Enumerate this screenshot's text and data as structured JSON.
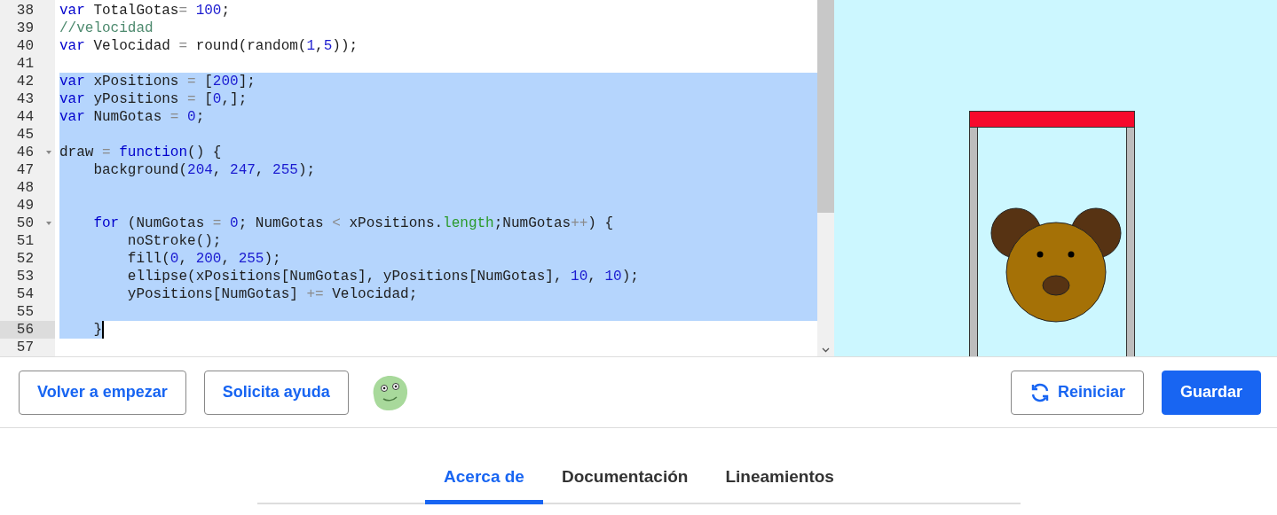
{
  "editor": {
    "lines": [
      {
        "number": "38",
        "selected": false,
        "active": false,
        "foldable": false,
        "tokens": [
          {
            "text": "var",
            "kind": "keyword"
          },
          {
            "text": " TotalGotas",
            "kind": "plain"
          },
          {
            "text": "=",
            "kind": "operator"
          },
          {
            "text": " 100",
            "kind": "number"
          },
          {
            "text": ";",
            "kind": "plain"
          }
        ]
      },
      {
        "number": "39",
        "selected": false,
        "active": false,
        "foldable": false,
        "tokens": [
          {
            "text": "//velocidad",
            "kind": "comment"
          }
        ]
      },
      {
        "number": "40",
        "selected": false,
        "active": false,
        "foldable": false,
        "tokens": [
          {
            "text": "var",
            "kind": "keyword"
          },
          {
            "text": " Velocidad ",
            "kind": "plain"
          },
          {
            "text": "=",
            "kind": "operator"
          },
          {
            "text": " round(random(",
            "kind": "plain"
          },
          {
            "text": "1",
            "kind": "number"
          },
          {
            "text": ",",
            "kind": "plain"
          },
          {
            "text": "5",
            "kind": "number"
          },
          {
            "text": "));",
            "kind": "plain"
          }
        ]
      },
      {
        "number": "41",
        "selected": false,
        "active": false,
        "foldable": false
      },
      {
        "number": "42",
        "selected": true,
        "active": false,
        "foldable": false,
        "tokens": [
          {
            "text": "var",
            "kind": "keyword"
          },
          {
            "text": " xPositions ",
            "kind": "plain"
          },
          {
            "text": "=",
            "kind": "operator"
          },
          {
            "text": " [",
            "kind": "plain"
          },
          {
            "text": "200",
            "kind": "number"
          },
          {
            "text": "];",
            "kind": "plain"
          }
        ]
      },
      {
        "number": "43",
        "selected": true,
        "active": false,
        "foldable": false,
        "tokens": [
          {
            "text": "var",
            "kind": "keyword"
          },
          {
            "text": " yPositions ",
            "kind": "plain"
          },
          {
            "text": "=",
            "kind": "operator"
          },
          {
            "text": " [",
            "kind": "plain"
          },
          {
            "text": "0",
            "kind": "number"
          },
          {
            "text": ",];",
            "kind": "plain"
          }
        ]
      },
      {
        "number": "44",
        "selected": true,
        "active": false,
        "foldable": false,
        "tokens": [
          {
            "text": "var",
            "kind": "keyword"
          },
          {
            "text": " NumGotas ",
            "kind": "plain"
          },
          {
            "text": "=",
            "kind": "operator"
          },
          {
            "text": " 0",
            "kind": "number"
          },
          {
            "text": ";",
            "kind": "plain"
          }
        ]
      },
      {
        "number": "45",
        "selected": true,
        "active": false,
        "foldable": false
      },
      {
        "number": "46",
        "selected": true,
        "active": false,
        "foldable": true,
        "tokens": [
          {
            "text": "draw ",
            "kind": "plain"
          },
          {
            "text": "=",
            "kind": "operator"
          },
          {
            "text": " function",
            "kind": "keyword"
          },
          {
            "text": "() {",
            "kind": "plain"
          }
        ]
      },
      {
        "number": "47",
        "selected": true,
        "active": false,
        "foldable": false,
        "tokens": [
          {
            "text": "    background(",
            "kind": "plain"
          },
          {
            "text": "204",
            "kind": "number"
          },
          {
            "text": ", ",
            "kind": "plain"
          },
          {
            "text": "247",
            "kind": "number"
          },
          {
            "text": ", ",
            "kind": "plain"
          },
          {
            "text": "255",
            "kind": "number"
          },
          {
            "text": ");",
            "kind": "plain"
          }
        ]
      },
      {
        "number": "48",
        "selected": true,
        "active": false,
        "foldable": false
      },
      {
        "number": "49",
        "selected": true,
        "active": false,
        "foldable": false
      },
      {
        "number": "50",
        "selected": true,
        "active": false,
        "foldable": true,
        "tokens": [
          {
            "text": "    for",
            "kind": "keyword"
          },
          {
            "text": " (NumGotas ",
            "kind": "plain"
          },
          {
            "text": "=",
            "kind": "operator"
          },
          {
            "text": " 0",
            "kind": "number"
          },
          {
            "text": "; NumGotas ",
            "kind": "plain"
          },
          {
            "text": "<",
            "kind": "operator"
          },
          {
            "text": " xPositions.",
            "kind": "plain"
          },
          {
            "text": "length",
            "kind": "property"
          },
          {
            "text": ";NumGotas",
            "kind": "plain"
          },
          {
            "text": "++",
            "kind": "operator"
          },
          {
            "text": ") {",
            "kind": "plain"
          }
        ]
      },
      {
        "number": "51",
        "selected": true,
        "active": false,
        "foldable": false,
        "tokens": [
          {
            "text": "        noStroke();",
            "kind": "plain"
          }
        ]
      },
      {
        "number": "52",
        "selected": true,
        "active": false,
        "foldable": false,
        "tokens": [
          {
            "text": "        fill(",
            "kind": "plain"
          },
          {
            "text": "0",
            "kind": "number"
          },
          {
            "text": ", ",
            "kind": "plain"
          },
          {
            "text": "200",
            "kind": "number"
          },
          {
            "text": ", ",
            "kind": "plain"
          },
          {
            "text": "255",
            "kind": "number"
          },
          {
            "text": ");",
            "kind": "plain"
          }
        ]
      },
      {
        "number": "53",
        "selected": true,
        "active": false,
        "foldable": false,
        "tokens": [
          {
            "text": "        ellipse(xPositions[NumGotas], yPositions[NumGotas], ",
            "kind": "plain"
          },
          {
            "text": "10",
            "kind": "number"
          },
          {
            "text": ", ",
            "kind": "plain"
          },
          {
            "text": "10",
            "kind": "number"
          },
          {
            "text": ");",
            "kind": "plain"
          }
        ]
      },
      {
        "number": "54",
        "selected": true,
        "active": false,
        "foldable": false,
        "tokens": [
          {
            "text": "        yPositions[NumGotas] ",
            "kind": "plain"
          },
          {
            "text": "+=",
            "kind": "operator"
          },
          {
            "text": " Velocidad;",
            "kind": "plain"
          }
        ]
      },
      {
        "number": "55",
        "selected": true,
        "active": false,
        "foldable": false
      },
      {
        "number": "56",
        "selected": true,
        "active": true,
        "foldable": false,
        "tokens": [
          {
            "text": "    }",
            "kind": "plain"
          }
        ]
      },
      {
        "number": "57",
        "selected": false,
        "active": false,
        "foldable": false
      }
    ]
  },
  "toolbar": {
    "left_buttons": [
      "Volver a empezar",
      "Solicita ayuda"
    ],
    "restart_button": "Reiniciar",
    "save_button": "Guardar"
  },
  "tabs": [
    {
      "label": "Acerca de",
      "selected": true
    },
    {
      "label": "Documentación",
      "selected": false
    },
    {
      "label": "Lineamientos",
      "selected": false
    }
  ]
}
